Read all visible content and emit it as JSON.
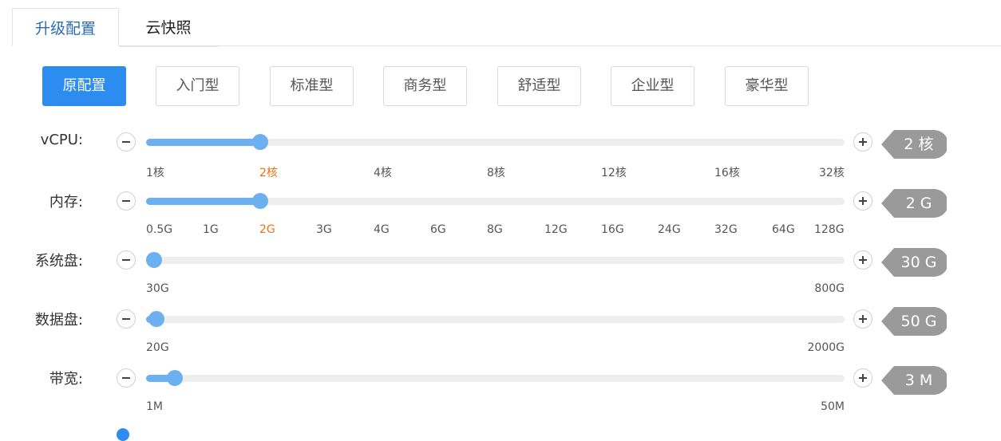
{
  "tabs": [
    {
      "label": "升级配置",
      "active": true
    },
    {
      "label": "云快照",
      "active": false
    }
  ],
  "presets": [
    {
      "label": "原配置",
      "active": true
    },
    {
      "label": "入门型"
    },
    {
      "label": "标准型"
    },
    {
      "label": "商务型"
    },
    {
      "label": "舒适型"
    },
    {
      "label": "企业型"
    },
    {
      "label": "豪华型"
    }
  ],
  "colors": {
    "accent": "#2c8cf0",
    "slider": "#6cb0ef",
    "selected_tick": "#e8731a",
    "value_tag": "#9a9a9a"
  },
  "rows": [
    {
      "label": "vCPU:",
      "value_display": "2 核",
      "ticks": [
        "1核",
        "2核",
        "4核",
        "8核",
        "12核",
        "16核",
        "32核"
      ],
      "selected_index": 1,
      "level": 0.163
    },
    {
      "label": "内存:",
      "value_display": "2 G",
      "ticks": [
        "0.5G",
        "1G",
        "2G",
        "3G",
        "4G",
        "6G",
        "8G",
        "12G",
        "16G",
        "24G",
        "32G",
        "64G",
        "128G"
      ],
      "selected_index": 2,
      "level": 0.163
    },
    {
      "label": "系统盘:",
      "value_display": "30 G",
      "ticks": [
        "30G",
        "800G"
      ],
      "selected_index": -1,
      "level": 0.0
    },
    {
      "label": "数据盘:",
      "value_display": "50 G",
      "ticks": [
        "20G",
        "2000G"
      ],
      "selected_index": -1,
      "level": 0.015
    },
    {
      "label": "带宽:",
      "value_display": "3 M",
      "ticks": [
        "1M",
        "50M"
      ],
      "selected_index": -1,
      "level": 0.041
    }
  ],
  "icons": {
    "decrement": "minus-icon",
    "increment": "plus-icon"
  }
}
